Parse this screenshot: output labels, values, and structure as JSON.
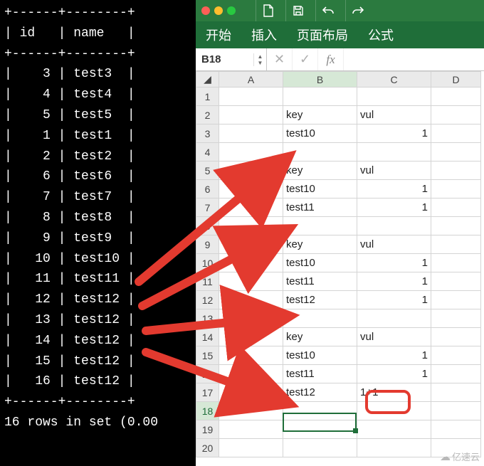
{
  "terminal": {
    "divider_row": "+------+--------+",
    "header_row": "| id   | name   |",
    "data_rows": [
      "|    3 | test3  |",
      "|    4 | test4  |",
      "|    5 | test5  |",
      "|    1 | test1  |",
      "|    2 | test2  |",
      "|    6 | test6  |",
      "|    7 | test7  |",
      "|    8 | test8  |",
      "|    9 | test9  |",
      "|   10 | test10 |",
      "|   11 | test11 |",
      "|   12 | test12 |",
      "|   13 | test12 |",
      "|   14 | test12 |",
      "|   15 | test12 |",
      "|   16 | test12 |"
    ],
    "footer": "16 rows in set (0.00"
  },
  "excel": {
    "tabs": {
      "home": "开始",
      "insert": "插入",
      "page_layout": "页面布局",
      "formula": "公式"
    },
    "name_box": "B18",
    "formula_value": "",
    "fx_label": "fx",
    "columns": [
      "A",
      "B",
      "C",
      "D"
    ],
    "rows": [
      {
        "n": 1,
        "A": "",
        "B": "",
        "C": ""
      },
      {
        "n": 2,
        "A": "",
        "B": "key",
        "C": "vul"
      },
      {
        "n": 3,
        "A": "",
        "B": "test10",
        "C": "1"
      },
      {
        "n": 4,
        "A": "",
        "B": "",
        "C": ""
      },
      {
        "n": 5,
        "A": "",
        "B": "key",
        "C": "vul"
      },
      {
        "n": 6,
        "A": "",
        "B": "test10",
        "C": "1"
      },
      {
        "n": 7,
        "A": "",
        "B": "test11",
        "C": "1"
      },
      {
        "n": 8,
        "A": "",
        "B": "",
        "C": ""
      },
      {
        "n": 9,
        "A": "",
        "B": "key",
        "C": "vul"
      },
      {
        "n": 10,
        "A": "",
        "B": "test10",
        "C": "1"
      },
      {
        "n": 11,
        "A": "",
        "B": "test11",
        "C": "1"
      },
      {
        "n": 12,
        "A": "",
        "B": "test12",
        "C": "1"
      },
      {
        "n": 13,
        "A": "",
        "B": "",
        "C": ""
      },
      {
        "n": 14,
        "A": "",
        "B": "key",
        "C": "vul"
      },
      {
        "n": 15,
        "A": "",
        "B": "test10",
        "C": "1"
      },
      {
        "n": 16,
        "A": "",
        "B": "test11",
        "C": "1"
      },
      {
        "n": 17,
        "A": "",
        "B": "test12",
        "C": "1+1"
      },
      {
        "n": 18,
        "A": "",
        "B": "",
        "C": ""
      },
      {
        "n": 19,
        "A": "",
        "B": "",
        "C": ""
      },
      {
        "n": 20,
        "A": "",
        "B": "",
        "C": ""
      }
    ],
    "active_cell": "B18"
  },
  "colors": {
    "ribbon": "#1f6e39",
    "titlebar": "#2b7a3f",
    "accent": "#1f6e39",
    "arrow": "#e33a2f"
  },
  "watermark": "亿速云"
}
